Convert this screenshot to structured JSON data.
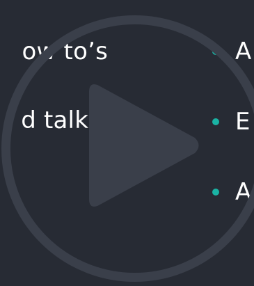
{
  "left_column": {
    "line_1": "ow to’s",
    "line_2": "d talks"
  },
  "right_column": {
    "items": [
      {
        "label": "A"
      },
      {
        "label": "E"
      },
      {
        "label": "A"
      }
    ]
  },
  "colors": {
    "background": "#272b34",
    "play_overlay": "#3a3f4a",
    "bullet": "#1ab3a4",
    "text": "#ffffff"
  },
  "icons": {
    "overlay": "play-icon",
    "bullet": "bullet-dot-icon"
  }
}
